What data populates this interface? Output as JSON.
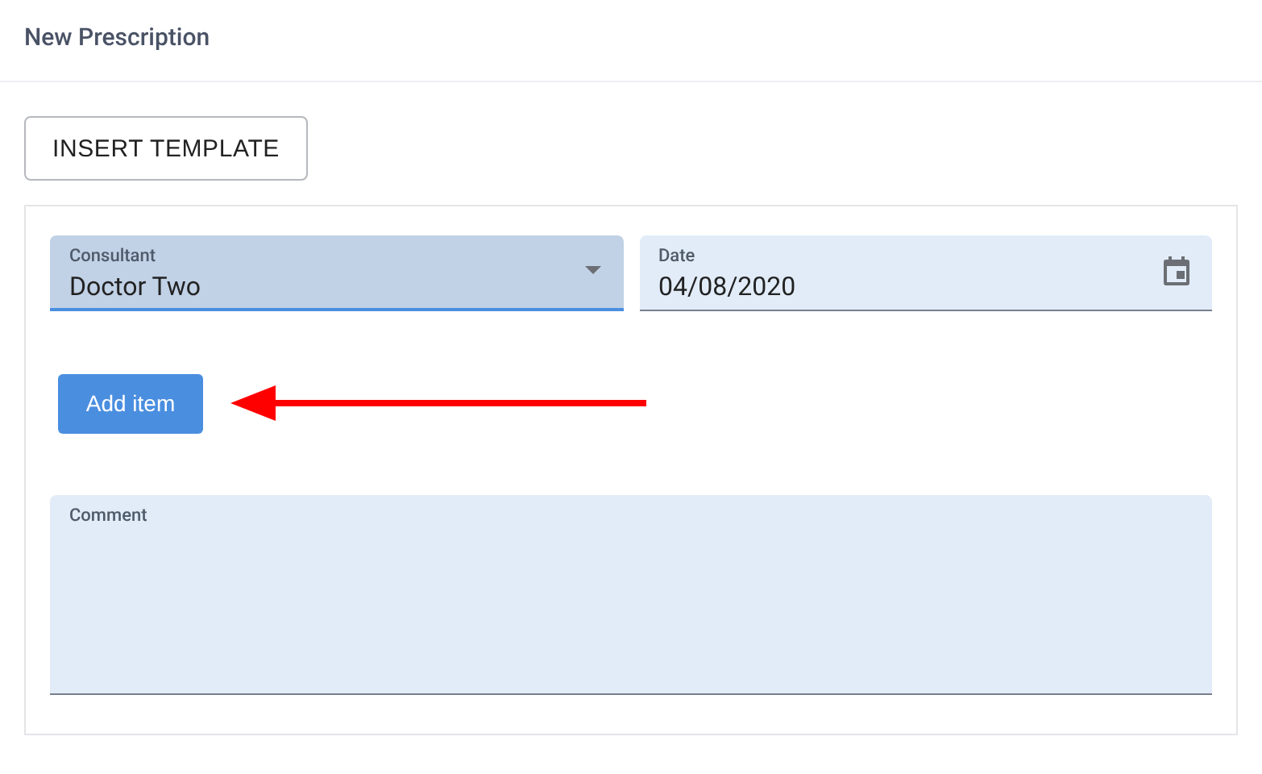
{
  "header": {
    "title": "New Prescription"
  },
  "template_button": {
    "label": "INSERT TEMPLATE"
  },
  "fields": [
    {
      "kind": "select",
      "label": "Consultant",
      "value": "Doctor Two",
      "focused": true
    },
    {
      "kind": "date",
      "label": "Date",
      "value": "04/08/2020",
      "focused": false
    }
  ],
  "add_button": {
    "label": "Add item"
  },
  "comment": {
    "label": "Comment",
    "focused": false
  }
}
